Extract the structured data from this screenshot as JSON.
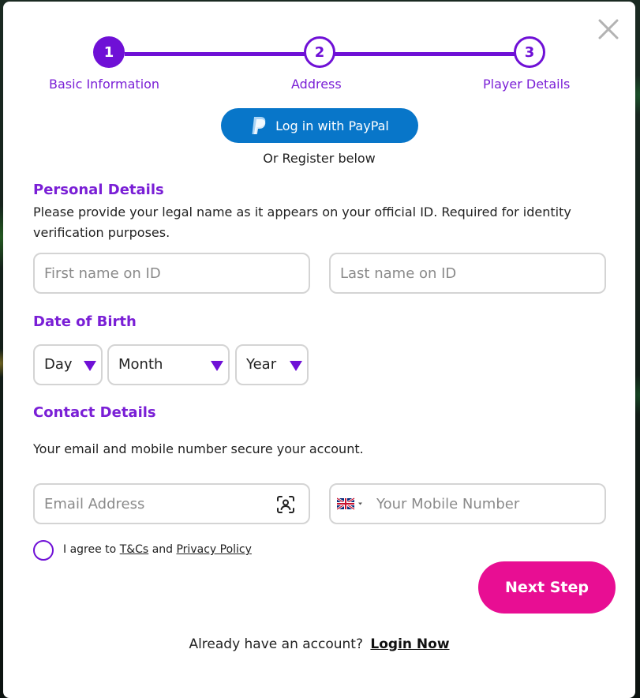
{
  "colors": {
    "accent_purple": "#6f10d6",
    "heading_purple": "#7a1fd6",
    "paypal_blue": "#0876c9",
    "cta_pink": "#e80e93",
    "border_gray": "#d4d4d4"
  },
  "stepper": {
    "steps": [
      {
        "number": "1",
        "label": "Basic Information",
        "state": "active"
      },
      {
        "number": "2",
        "label": "Address",
        "state": "inactive"
      },
      {
        "number": "3",
        "label": "Player Details",
        "state": "inactive"
      }
    ]
  },
  "close_icon": "close-icon",
  "paypal": {
    "label": "Log in with PayPal",
    "icon": "paypal-icon"
  },
  "or_register": "Or Register below",
  "personal": {
    "title": "Personal Details",
    "description": "Please provide your legal name as it appears on your official ID. Required for identity verification purposes.",
    "first_name_placeholder": "First name on ID",
    "last_name_placeholder": "Last name on ID",
    "first_name_value": "",
    "last_name_value": ""
  },
  "dob": {
    "title": "Date of Birth",
    "day_label": "Day",
    "month_label": "Month",
    "year_label": "Year"
  },
  "contact": {
    "title": "Contact Details",
    "description": "Your email and mobile number secure your account.",
    "email_placeholder": "Email Address",
    "email_value": "",
    "mobile_placeholder": "Your Mobile Number",
    "mobile_value": "",
    "email_icon": "face-id-icon",
    "country_flag": "uk-flag-icon"
  },
  "agreement": {
    "prefix": "I agree to",
    "tcs_link": "T&Cs",
    "conjunction": "and",
    "privacy_link": "Privacy Policy"
  },
  "next_button": "Next Step",
  "login_prompt": {
    "text": "Already have an account?",
    "link": "Login Now"
  }
}
